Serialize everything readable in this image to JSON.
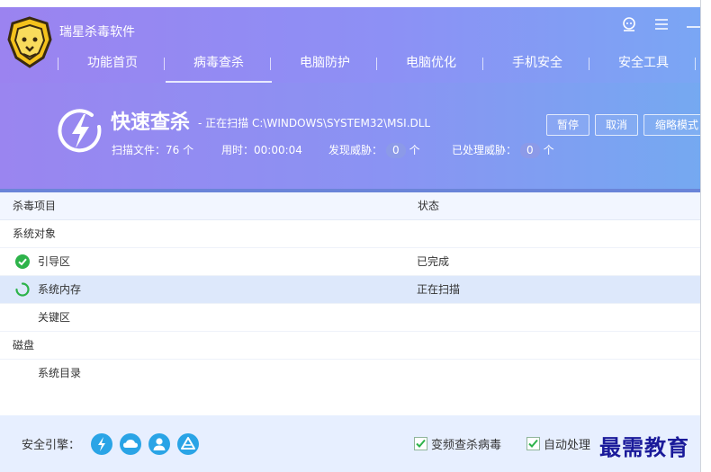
{
  "app": {
    "title": "瑞星杀毒软件",
    "colors": {
      "accent": "#8d90f5",
      "ok": "#2db34a",
      "engine": "#2aa4e6"
    }
  },
  "nav": {
    "tabs": [
      {
        "label": "功能首页"
      },
      {
        "label": "病毒查杀"
      },
      {
        "label": "电脑防护"
      },
      {
        "label": "电脑优化"
      },
      {
        "label": "手机安全"
      },
      {
        "label": "安全工具"
      }
    ],
    "active": "病毒查杀"
  },
  "scan": {
    "title": "快速查杀",
    "status_prefix": "- 正在扫描",
    "path": "C:\\WINDOWS\\SYSTEM32\\MSI.DLL",
    "files_label": "扫描文件：",
    "files_value": "76 个",
    "time_label": "用时：",
    "time_value": "00:00:04",
    "threats_label": "发现威胁：",
    "threats_value": "0",
    "threats_unit": "个",
    "handled_label": "已处理威胁：",
    "handled_value": "0",
    "handled_unit": "个",
    "buttons": {
      "pause": "暂停",
      "cancel": "取消",
      "mini": "缩略模式"
    }
  },
  "table": {
    "headers": {
      "item": "杀毒项目",
      "status": "状态"
    },
    "rows": [
      {
        "name": "系统对象",
        "status": "",
        "icon": "none",
        "indent": false
      },
      {
        "name": "引导区",
        "status": "已完成",
        "icon": "check-circle-icon",
        "indent": true
      },
      {
        "name": "系统内存",
        "status": "正在扫描",
        "icon": "spinner-icon",
        "indent": true
      },
      {
        "name": "关键区",
        "status": "",
        "icon": "none",
        "indent": true
      },
      {
        "name": "磁盘",
        "status": "",
        "icon": "none",
        "indent": false
      },
      {
        "name": "系统目录",
        "status": "",
        "icon": "none",
        "indent": true
      }
    ]
  },
  "footer": {
    "engine_label": "安全引擎：",
    "engines": [
      "lightning-icon",
      "cloud-icon",
      "user-icon",
      "drive-icon"
    ],
    "options": [
      {
        "label": "变频查杀病毒",
        "checked": true
      },
      {
        "label": "自动处理",
        "checked": true
      }
    ]
  },
  "watermark": "最需教育"
}
